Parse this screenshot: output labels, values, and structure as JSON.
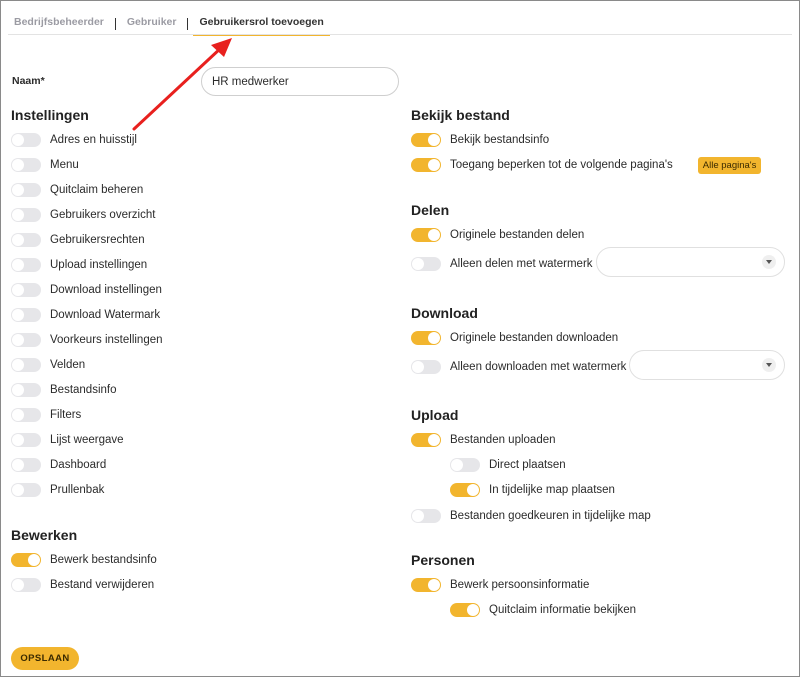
{
  "tabs": [
    {
      "label": "Bedrijfsbeheerder"
    },
    {
      "label": "Gebruiker"
    },
    {
      "label": "Gebruikersrol toevoegen"
    }
  ],
  "name": {
    "label": "Naam*",
    "value": "HR medwerker"
  },
  "instellingen": {
    "title": "Instellingen",
    "items": [
      {
        "label": "Adres en huisstijl",
        "on": false
      },
      {
        "label": "Menu",
        "on": false
      },
      {
        "label": "Quitclaim beheren",
        "on": false
      },
      {
        "label": "Gebruikers overzicht",
        "on": false
      },
      {
        "label": "Gebruikersrechten",
        "on": false
      },
      {
        "label": "Upload instellingen",
        "on": false
      },
      {
        "label": "Download instellingen",
        "on": false
      },
      {
        "label": "Download Watermark",
        "on": false
      },
      {
        "label": "Voorkeurs instellingen",
        "on": false
      },
      {
        "label": "Velden",
        "on": false
      },
      {
        "label": "Bestandsinfo",
        "on": false
      },
      {
        "label": "Filters",
        "on": false
      },
      {
        "label": "Lijst weergave",
        "on": false
      },
      {
        "label": "Dashboard",
        "on": false
      },
      {
        "label": "Prullenbak",
        "on": false
      }
    ]
  },
  "bewerken": {
    "title": "Bewerken",
    "items": [
      {
        "label": "Bewerk bestandsinfo",
        "on": true
      },
      {
        "label": "Bestand verwijderen",
        "on": false
      }
    ]
  },
  "bekijk": {
    "title": "Bekijk bestand",
    "items": [
      {
        "label": "Bekijk bestandsinfo",
        "on": true
      },
      {
        "label": "Toegang beperken tot de volgende pagina's",
        "on": true,
        "badge": "Alle pagina's"
      }
    ]
  },
  "delen": {
    "title": "Delen",
    "items": [
      {
        "label": "Originele bestanden delen",
        "on": true
      },
      {
        "label": "Alleen delen met watermerk",
        "on": false
      }
    ]
  },
  "download": {
    "title": "Download",
    "items": [
      {
        "label": "Originele bestanden downloaden",
        "on": true
      },
      {
        "label": "Alleen downloaden met watermerk",
        "on": false
      }
    ]
  },
  "upload": {
    "title": "Upload",
    "items": [
      {
        "label": "Bestanden uploaden",
        "on": true
      },
      {
        "label": "Direct plaatsen",
        "on": false
      },
      {
        "label": "In tijdelijke map plaatsen",
        "on": true
      },
      {
        "label": "Bestanden goedkeuren in tijdelijke map",
        "on": false
      }
    ]
  },
  "personen": {
    "title": "Personen",
    "items": [
      {
        "label": "Bewerk persoonsinformatie",
        "on": true
      },
      {
        "label": "Quitclaim informatie bekijken",
        "on": true
      }
    ]
  },
  "save_label": "OPSLAAN",
  "colors": {
    "accent": "#f2b52e",
    "arrow": "#e8201e"
  }
}
